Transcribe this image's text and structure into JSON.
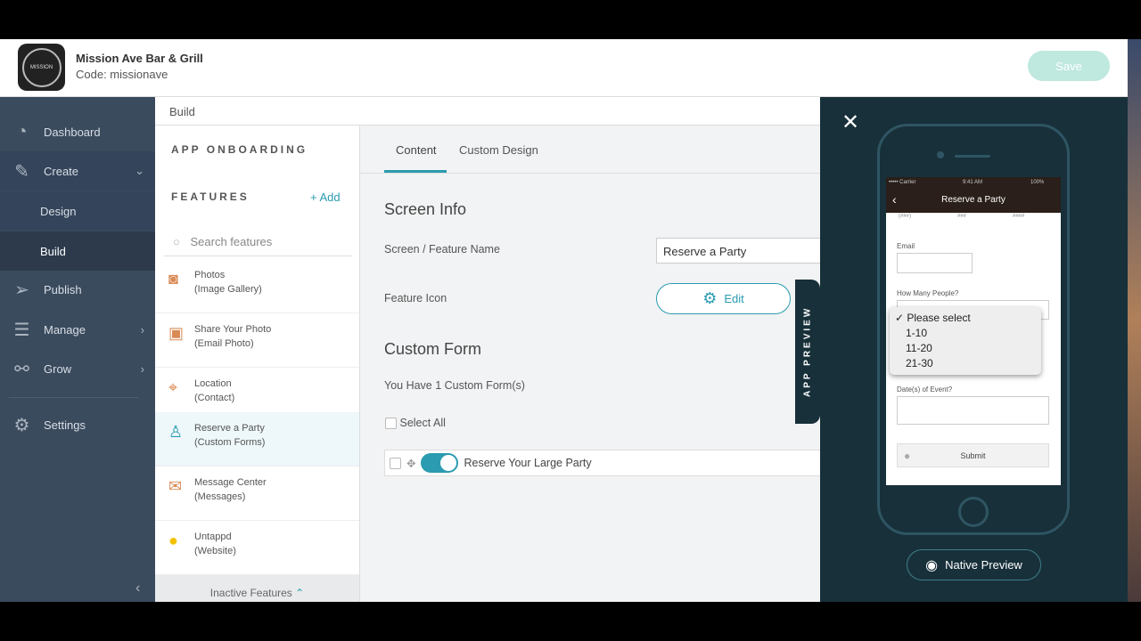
{
  "header": {
    "app_name": "Mission Ave Bar & Grill",
    "app_code": "Code: missionave",
    "logo_text": "MISSION-AVENUE",
    "save_label": "Save"
  },
  "sidebar": {
    "items": [
      {
        "label": "Dashboard",
        "icon": "gauge-icon"
      },
      {
        "label": "Create",
        "icon": "pencil-icon"
      },
      {
        "label": "Design"
      },
      {
        "label": "Build"
      },
      {
        "label": "Publish",
        "icon": "paper-plane-icon"
      },
      {
        "label": "Manage",
        "icon": "sliders-icon"
      },
      {
        "label": "Grow",
        "icon": "graph-icon"
      },
      {
        "label": "Settings",
        "icon": "gear-icon"
      }
    ],
    "collapse": "‹"
  },
  "breadcrumb": "Build",
  "features": {
    "onboarding": "APP ONBOARDING",
    "title": "FEATURES",
    "add": "+ Add",
    "search_placeholder": "Search features",
    "items": [
      {
        "name": "Photos",
        "sub": "(Image Gallery)"
      },
      {
        "name": "Share Your Photo",
        "sub": "(Email Photo)"
      },
      {
        "name": "Location",
        "sub": "(Contact)"
      },
      {
        "name": "Reserve a Party",
        "sub": "(Custom Forms)"
      },
      {
        "name": "Message Center",
        "sub": "(Messages)"
      },
      {
        "name": "Untappd",
        "sub": "(Website)"
      }
    ],
    "inactive": "Inactive Features"
  },
  "main": {
    "tabs": [
      "Content",
      "Custom Design"
    ],
    "screen_info": "Screen Info",
    "name_label": "Screen / Feature Name",
    "name_value": "Reserve a Party",
    "icon_label": "Feature Icon",
    "edit": "Edit",
    "custom_form": "Custom Form",
    "form_count": "You Have 1 Custom Form(s)",
    "select_all": "Select All",
    "form_name": "Reserve Your Large Party"
  },
  "preview": {
    "tab": "APP PREVIEW",
    "status": {
      "carrier": "••••• Carrier",
      "time": "9:41 AM",
      "battery": "100%"
    },
    "title": "Reserve a Party",
    "phone_placeholders": [
      "(###)",
      "###",
      "####"
    ],
    "email": "Email",
    "people": "How Many People?",
    "options": [
      "Please select",
      "1-10",
      "11-20",
      "21-30"
    ],
    "dates": "Date(s) of Event?",
    "submit": "Submit",
    "native": "Native Preview"
  },
  "colors": {
    "accent": "#2a9bb0",
    "sidebar": "#3b4b5e",
    "preview_bg": "#17303a"
  }
}
